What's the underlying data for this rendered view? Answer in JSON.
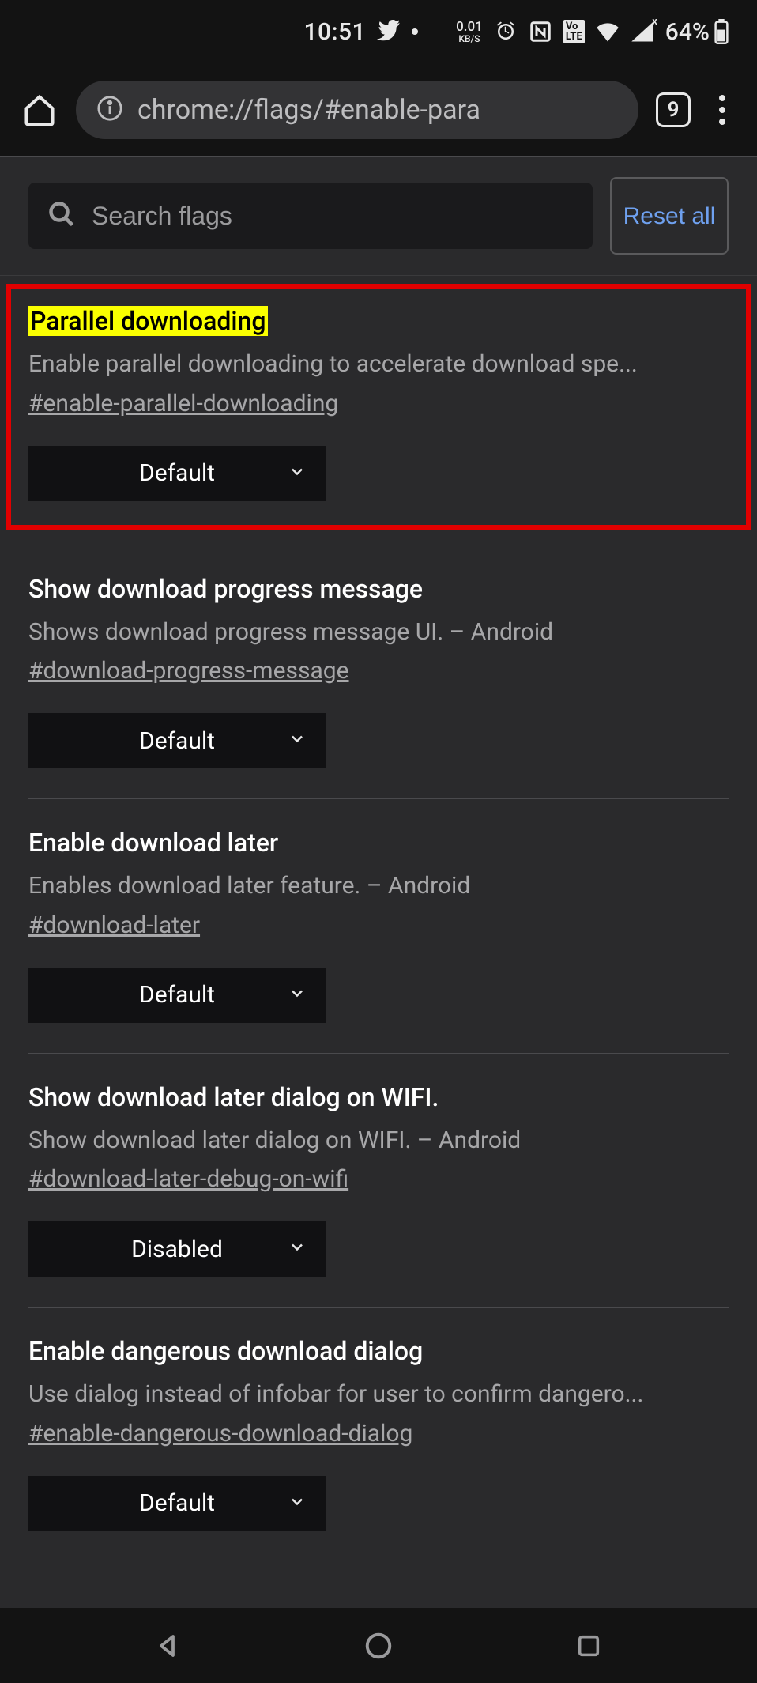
{
  "status": {
    "time": "10:51",
    "kbs_value": "0.01",
    "kbs_label": "KB/S",
    "volte": "Vo LTE",
    "battery_pct": "64%"
  },
  "toolbar": {
    "url": "chrome://flags/#enable-para",
    "tab_count": "9"
  },
  "search": {
    "placeholder": "Search flags",
    "reset_label": "Reset all"
  },
  "flags": [
    {
      "title": "Parallel downloading",
      "desc": "Enable parallel downloading to accelerate download spe...",
      "hash": "#enable-parallel-downloading",
      "value": "Default",
      "highlighted": true,
      "boxed": true
    },
    {
      "title": "Show download progress message",
      "desc": "Shows download progress message UI. – Android",
      "hash": "#download-progress-message",
      "value": "Default"
    },
    {
      "title": "Enable download later",
      "desc": "Enables download later feature. – Android",
      "hash": "#download-later",
      "value": "Default"
    },
    {
      "title": "Show download later dialog on WIFI.",
      "desc": "Show download later dialog on WIFI. – Android",
      "hash": "#download-later-debug-on-wifi",
      "value": "Disabled"
    },
    {
      "title": "Enable dangerous download dialog",
      "desc": "Use dialog instead of infobar for user to confirm dangero...",
      "hash": "#enable-dangerous-download-dialog",
      "value": "Default"
    }
  ]
}
